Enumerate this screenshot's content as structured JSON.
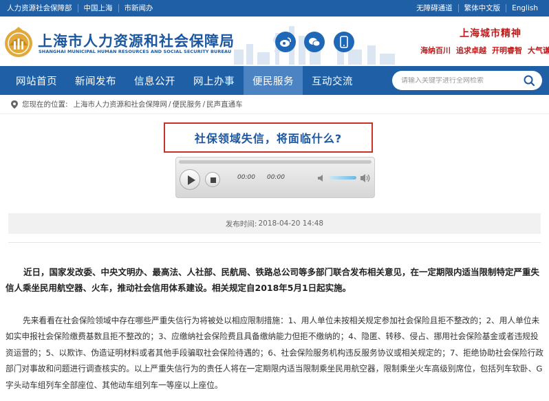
{
  "topbar": {
    "left_links": [
      "人力资源社会保障部",
      "中国上海",
      "市新闻办"
    ],
    "right_links": [
      "无障碍通道",
      "繁体中文版",
      "English"
    ]
  },
  "header": {
    "title_cn": "上海市人力资源和社会保障局",
    "title_en": "SHANGHAI MUNICIPAL HUMAN RESOURCES AND SOCIAL SECURITY BUREAU",
    "social_icons": [
      "weibo-icon",
      "wechat-icon",
      "mobile-icon"
    ],
    "spirit_title": "上海城市精神",
    "spirit_words": [
      "海纳百川",
      "追求卓越",
      "开明睿智",
      "大气谦和"
    ]
  },
  "nav": {
    "items": [
      "网站首页",
      "新闻发布",
      "信息公开",
      "网上办事",
      "便民服务",
      "互动交流"
    ],
    "active_index": 4,
    "search_placeholder": "请输入关键字进行全网检索"
  },
  "breadcrumb": {
    "label": "您现在的位置:",
    "items": [
      "上海市人力资源和社会保障网",
      "便民服务",
      "民声直通车"
    ],
    "separator": "/"
  },
  "article": {
    "headline": "社保领域失信，将面临什么?",
    "player": {
      "current_time": "00:00",
      "duration": "00:00"
    },
    "pub_label": "发布时间:",
    "pub_date": "2018-04-20 14:48",
    "lead": "近日，国家发改委、中央文明办、最高法、人社部、民航局、铁路总公司等多部门联合发布相关意见，在一定期限内适当限制特定严重失信人乘坐民用航空器、火车，推动社会信用体系建设。相关规定自2018年5月1日起实施。",
    "body": "先来看看在社会保险领域中存在哪些严重失信行为将被处以相应限制措施：1、用人单位未按相关规定参加社会保险且拒不整改的；2、用人单位未如实申报社会保险缴费基数且拒不整改的；3、应缴纳社会保险费且具备缴纳能力但拒不缴纳的；4、隐匿、转移、侵占、挪用社会保险基金或者违规投资运营的；5、以欺诈、伪造证明材料或者其他手段骗取社会保险待遇的；6、社会保险服务机构违反服务协议或相关规定的；7、拒绝协助社会保险行政部门对事故和问题进行调查核实的。以上严重失信行为的责任人将在一定期限内适当限制乘坐民用航空器，限制乘坐火车高级别席位，包括列车软卧、G字头动车组列车全部座位、其他动车组列车一等座以上座位。"
  },
  "colors": {
    "primary": "#1f5fa5",
    "nav_active": "#4c83c3",
    "accent_red": "#c9302c"
  }
}
